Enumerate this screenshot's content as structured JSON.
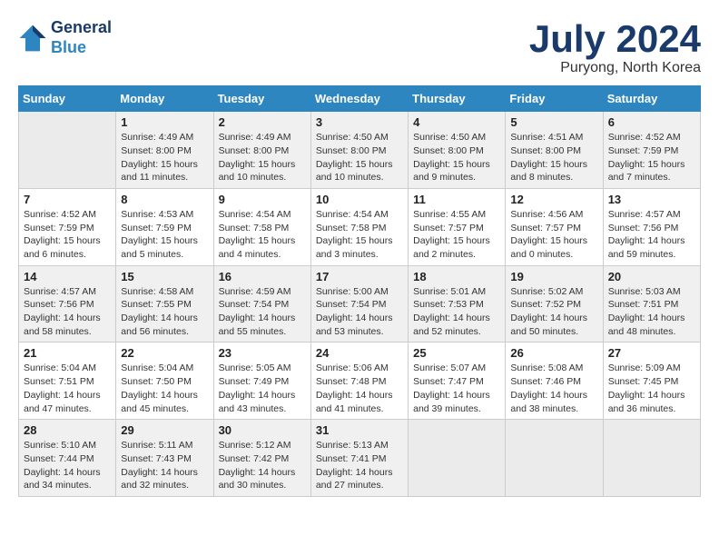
{
  "header": {
    "logo_line1": "General",
    "logo_line2": "Blue",
    "month_title": "July 2024",
    "location": "Puryong, North Korea"
  },
  "weekdays": [
    "Sunday",
    "Monday",
    "Tuesday",
    "Wednesday",
    "Thursday",
    "Friday",
    "Saturday"
  ],
  "weeks": [
    [
      {
        "day": "",
        "info": ""
      },
      {
        "day": "1",
        "info": "Sunrise: 4:49 AM\nSunset: 8:00 PM\nDaylight: 15 hours\nand 11 minutes."
      },
      {
        "day": "2",
        "info": "Sunrise: 4:49 AM\nSunset: 8:00 PM\nDaylight: 15 hours\nand 10 minutes."
      },
      {
        "day": "3",
        "info": "Sunrise: 4:50 AM\nSunset: 8:00 PM\nDaylight: 15 hours\nand 10 minutes."
      },
      {
        "day": "4",
        "info": "Sunrise: 4:50 AM\nSunset: 8:00 PM\nDaylight: 15 hours\nand 9 minutes."
      },
      {
        "day": "5",
        "info": "Sunrise: 4:51 AM\nSunset: 8:00 PM\nDaylight: 15 hours\nand 8 minutes."
      },
      {
        "day": "6",
        "info": "Sunrise: 4:52 AM\nSunset: 7:59 PM\nDaylight: 15 hours\nand 7 minutes."
      }
    ],
    [
      {
        "day": "7",
        "info": "Sunrise: 4:52 AM\nSunset: 7:59 PM\nDaylight: 15 hours\nand 6 minutes."
      },
      {
        "day": "8",
        "info": "Sunrise: 4:53 AM\nSunset: 7:59 PM\nDaylight: 15 hours\nand 5 minutes."
      },
      {
        "day": "9",
        "info": "Sunrise: 4:54 AM\nSunset: 7:58 PM\nDaylight: 15 hours\nand 4 minutes."
      },
      {
        "day": "10",
        "info": "Sunrise: 4:54 AM\nSunset: 7:58 PM\nDaylight: 15 hours\nand 3 minutes."
      },
      {
        "day": "11",
        "info": "Sunrise: 4:55 AM\nSunset: 7:57 PM\nDaylight: 15 hours\nand 2 minutes."
      },
      {
        "day": "12",
        "info": "Sunrise: 4:56 AM\nSunset: 7:57 PM\nDaylight: 15 hours\nand 0 minutes."
      },
      {
        "day": "13",
        "info": "Sunrise: 4:57 AM\nSunset: 7:56 PM\nDaylight: 14 hours\nand 59 minutes."
      }
    ],
    [
      {
        "day": "14",
        "info": "Sunrise: 4:57 AM\nSunset: 7:56 PM\nDaylight: 14 hours\nand 58 minutes."
      },
      {
        "day": "15",
        "info": "Sunrise: 4:58 AM\nSunset: 7:55 PM\nDaylight: 14 hours\nand 56 minutes."
      },
      {
        "day": "16",
        "info": "Sunrise: 4:59 AM\nSunset: 7:54 PM\nDaylight: 14 hours\nand 55 minutes."
      },
      {
        "day": "17",
        "info": "Sunrise: 5:00 AM\nSunset: 7:54 PM\nDaylight: 14 hours\nand 53 minutes."
      },
      {
        "day": "18",
        "info": "Sunrise: 5:01 AM\nSunset: 7:53 PM\nDaylight: 14 hours\nand 52 minutes."
      },
      {
        "day": "19",
        "info": "Sunrise: 5:02 AM\nSunset: 7:52 PM\nDaylight: 14 hours\nand 50 minutes."
      },
      {
        "day": "20",
        "info": "Sunrise: 5:03 AM\nSunset: 7:51 PM\nDaylight: 14 hours\nand 48 minutes."
      }
    ],
    [
      {
        "day": "21",
        "info": "Sunrise: 5:04 AM\nSunset: 7:51 PM\nDaylight: 14 hours\nand 47 minutes."
      },
      {
        "day": "22",
        "info": "Sunrise: 5:04 AM\nSunset: 7:50 PM\nDaylight: 14 hours\nand 45 minutes."
      },
      {
        "day": "23",
        "info": "Sunrise: 5:05 AM\nSunset: 7:49 PM\nDaylight: 14 hours\nand 43 minutes."
      },
      {
        "day": "24",
        "info": "Sunrise: 5:06 AM\nSunset: 7:48 PM\nDaylight: 14 hours\nand 41 minutes."
      },
      {
        "day": "25",
        "info": "Sunrise: 5:07 AM\nSunset: 7:47 PM\nDaylight: 14 hours\nand 39 minutes."
      },
      {
        "day": "26",
        "info": "Sunrise: 5:08 AM\nSunset: 7:46 PM\nDaylight: 14 hours\nand 38 minutes."
      },
      {
        "day": "27",
        "info": "Sunrise: 5:09 AM\nSunset: 7:45 PM\nDaylight: 14 hours\nand 36 minutes."
      }
    ],
    [
      {
        "day": "28",
        "info": "Sunrise: 5:10 AM\nSunset: 7:44 PM\nDaylight: 14 hours\nand 34 minutes."
      },
      {
        "day": "29",
        "info": "Sunrise: 5:11 AM\nSunset: 7:43 PM\nDaylight: 14 hours\nand 32 minutes."
      },
      {
        "day": "30",
        "info": "Sunrise: 5:12 AM\nSunset: 7:42 PM\nDaylight: 14 hours\nand 30 minutes."
      },
      {
        "day": "31",
        "info": "Sunrise: 5:13 AM\nSunset: 7:41 PM\nDaylight: 14 hours\nand 27 minutes."
      },
      {
        "day": "",
        "info": ""
      },
      {
        "day": "",
        "info": ""
      },
      {
        "day": "",
        "info": ""
      }
    ]
  ]
}
